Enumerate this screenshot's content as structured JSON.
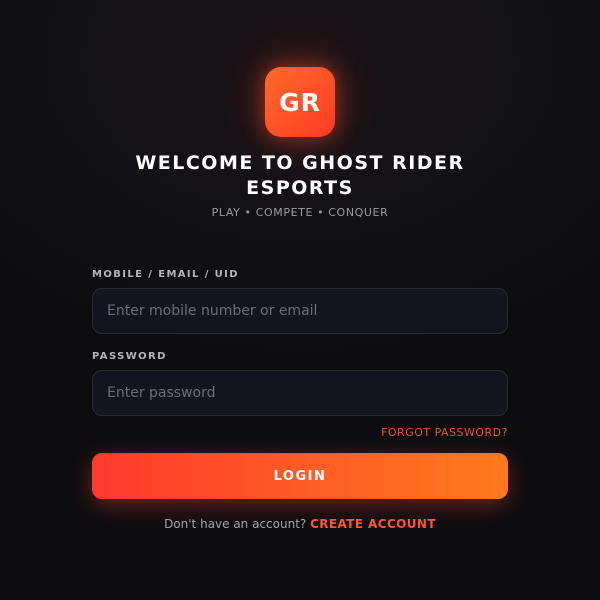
{
  "brand": {
    "logo_text": "GR",
    "title_line1": "WELCOME TO GHOST RIDER",
    "title_line2": "ESPORTS",
    "tagline": "PLAY • COMPETE • CONQUER"
  },
  "form": {
    "identifier_label": "MOBILE / EMAIL / UID",
    "identifier_placeholder": "Enter mobile number or email",
    "password_label": "PASSWORD",
    "password_placeholder": "Enter password",
    "forgot_password": "FORGOT PASSWORD?",
    "login_button": "LOGIN"
  },
  "signup": {
    "prompt": "Don't have an account?",
    "link": "CREATE ACCOUNT"
  },
  "colors": {
    "accent": "#ff4a2a",
    "accent_end": "#ff7a1c",
    "background": "#121216",
    "field_background": "#14151c"
  }
}
